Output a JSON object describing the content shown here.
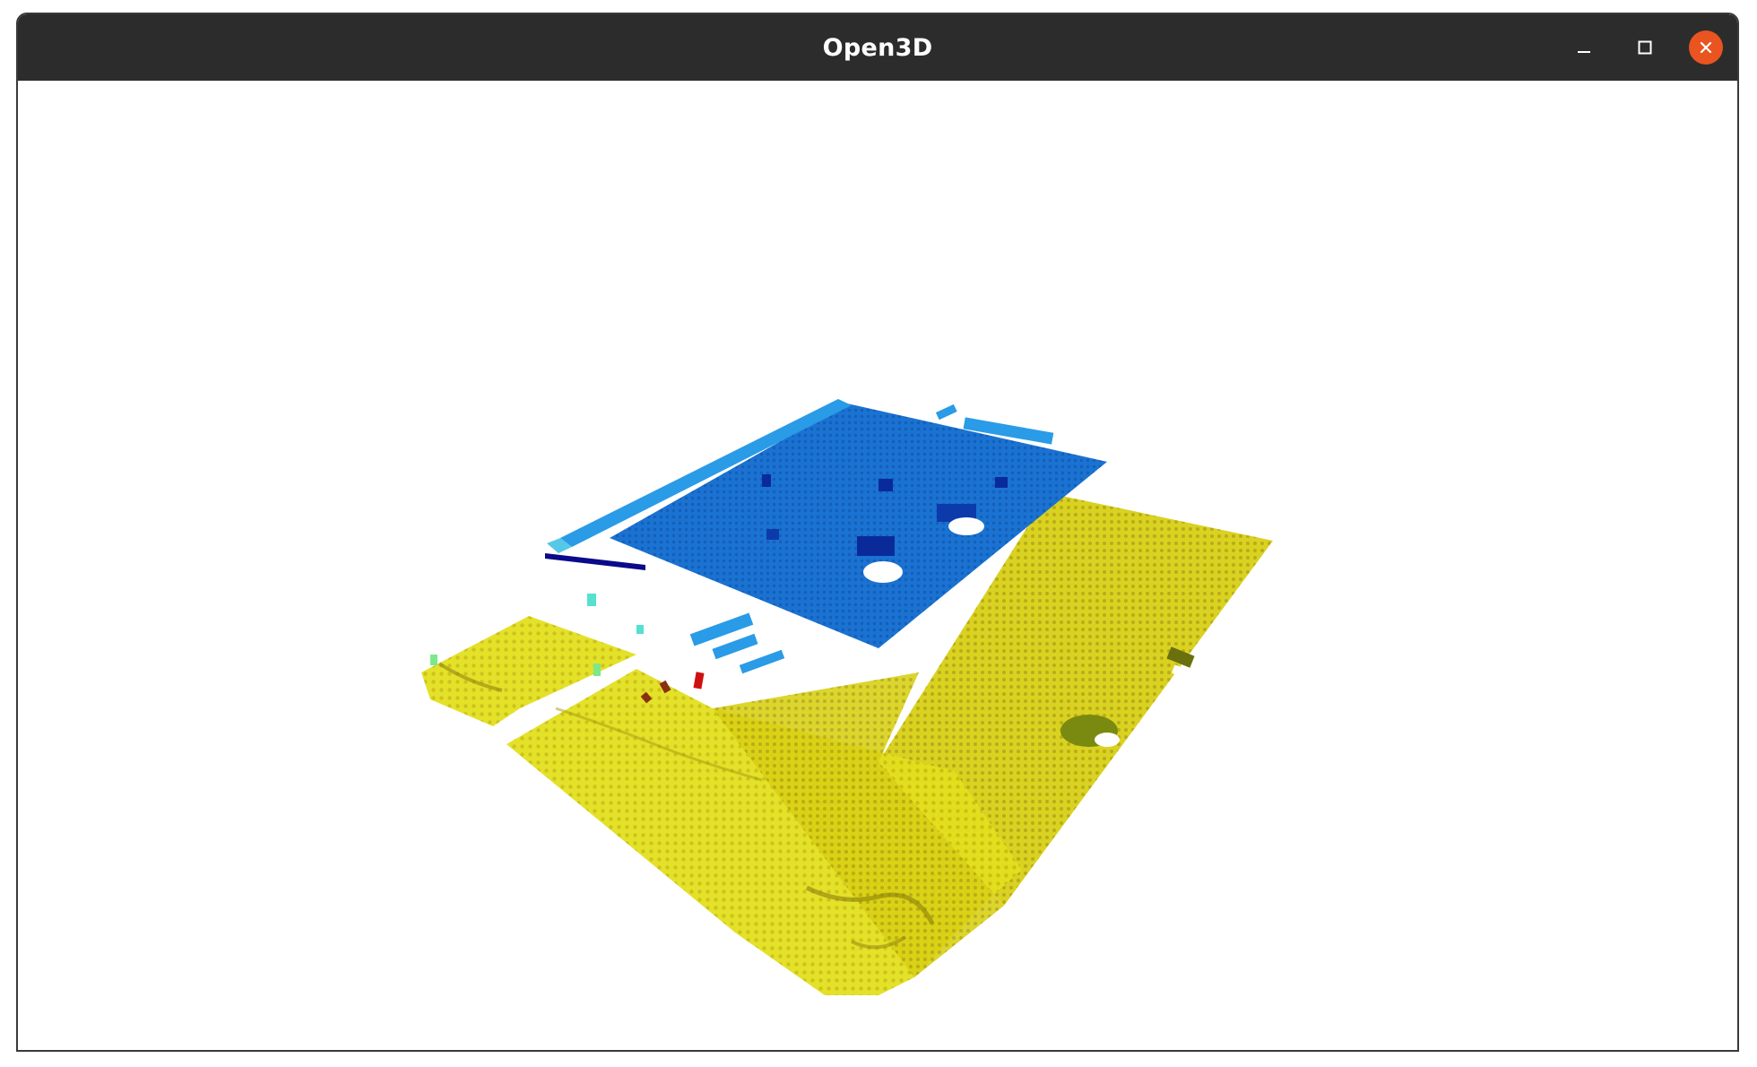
{
  "window": {
    "title": "Open3D"
  },
  "controls": {
    "minimize_icon": "minimize-icon",
    "maximize_icon": "maximize-icon",
    "close_icon": "close-icon",
    "close_color": "#e95420"
  },
  "scene": {
    "background": "#ffffff",
    "colors": {
      "blue_plane": "#1a6fd0",
      "blue_light": "#2a9be6",
      "cyan": "#55e0d0",
      "yellow_light": "#e6e61a",
      "yellow": "#d4cc10",
      "olive": "#9a8f10",
      "dark_blue": "#0a0a8a",
      "red": "#d01010",
      "brown": "#8a3010"
    }
  }
}
